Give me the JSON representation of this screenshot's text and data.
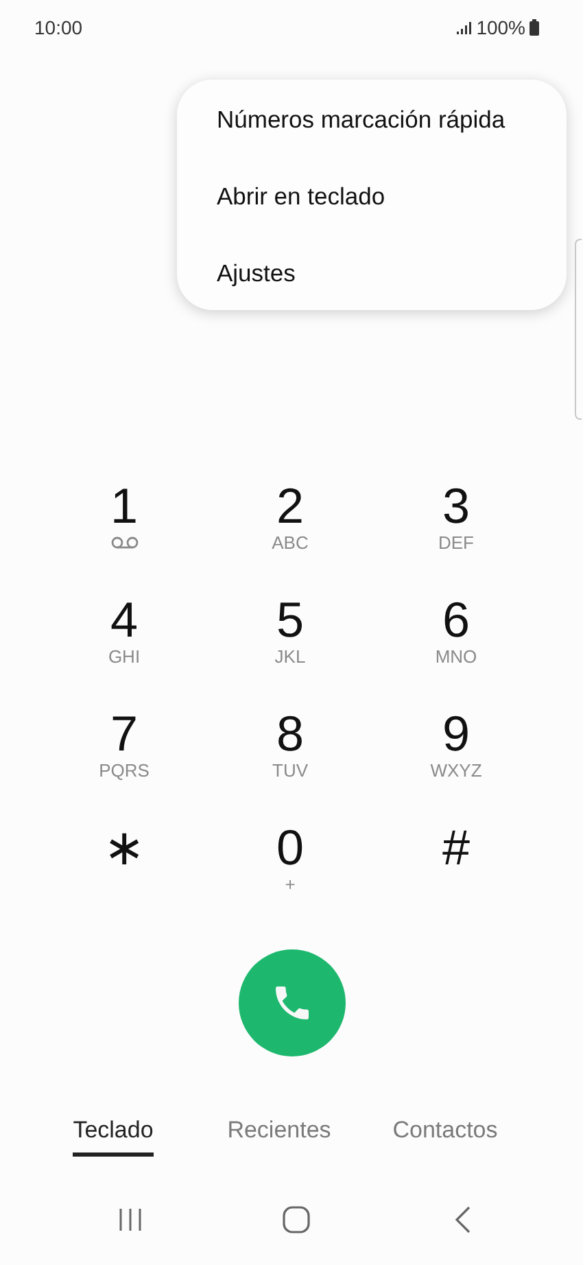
{
  "status_bar": {
    "time": "10:00",
    "battery": "100%"
  },
  "menu": {
    "items": [
      {
        "label": "Números marcación rápida"
      },
      {
        "label": "Abrir en teclado"
      },
      {
        "label": "Ajustes"
      }
    ]
  },
  "keypad": [
    {
      "digit": "1",
      "kind": "voicemail"
    },
    {
      "digit": "2",
      "letters": "ABC",
      "kind": "letters"
    },
    {
      "digit": "3",
      "letters": "DEF",
      "kind": "letters"
    },
    {
      "digit": "4",
      "letters": "GHI",
      "kind": "letters"
    },
    {
      "digit": "5",
      "letters": "JKL",
      "kind": "letters"
    },
    {
      "digit": "6",
      "letters": "MNO",
      "kind": "letters"
    },
    {
      "digit": "7",
      "letters": "PQRS",
      "kind": "letters"
    },
    {
      "digit": "8",
      "letters": "TUV",
      "kind": "letters"
    },
    {
      "digit": "9",
      "letters": "WXYZ",
      "kind": "letters"
    },
    {
      "digit": "∗",
      "kind": "plain"
    },
    {
      "digit": "0",
      "letters": "+",
      "kind": "letters"
    },
    {
      "digit": "#",
      "kind": "plain"
    }
  ],
  "tabs": [
    {
      "label": "Teclado",
      "selected": true
    },
    {
      "label": "Recientes",
      "selected": false
    },
    {
      "label": "Contactos",
      "selected": false
    }
  ]
}
